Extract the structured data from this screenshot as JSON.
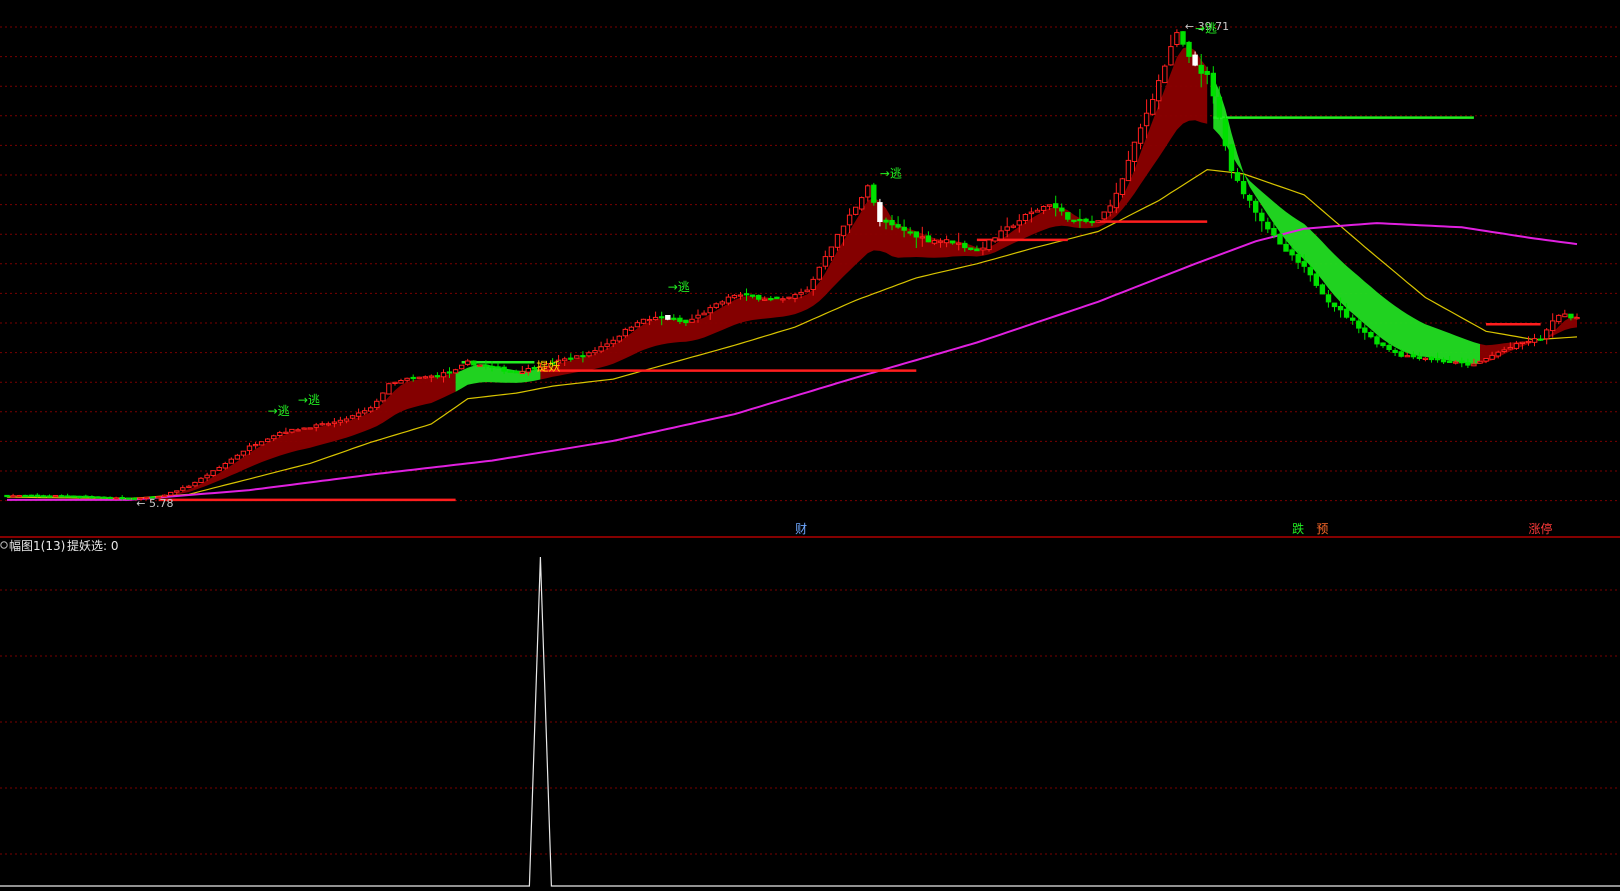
{
  "panel": {
    "title": "幅图1(13)",
    "indicator_label": "提妖选",
    "indicator_value": "0",
    "indicator_text": "提妖选: 0"
  },
  "colors": {
    "background": "#000000",
    "grid": "#7a0000",
    "panel_divider": "#b00000",
    "candle_up": "#ff1e1e",
    "candle_down": "#00e000",
    "candle_special": "#ffffff",
    "band_up": "#8b0000",
    "band_down": "#22dd22",
    "ma_yellow": "#d8c400",
    "ma_magenta": "#e020e0",
    "support_line": "#ff1e1e",
    "resist_line": "#22ee22",
    "sub_line": "#e8e8e8",
    "sell_label": "#22ee22",
    "price_label": "#c8c8c8",
    "tiyao_label": "#ffd000",
    "bottom_cai": "#6fa8ff",
    "bottom_die": "#22ee22",
    "bottom_yu": "#ff6a2a",
    "bottom_zhangting": "#ff3a3a"
  },
  "chart_data": [
    {
      "type": "candlestick",
      "title": "",
      "y_range": [
        5,
        41
      ],
      "candle_count": 260,
      "price_labels": [
        {
          "text": "39.71",
          "value": 39.71,
          "bar": 193
        },
        {
          "text": "5.78",
          "value": 5.78,
          "bar": 20
        }
      ],
      "sell_signals": [
        {
          "text": "逃",
          "bar": 42
        },
        {
          "text": "逃",
          "bar": 47
        },
        {
          "text": "逃",
          "bar": 108
        },
        {
          "text": "逃",
          "bar": 143
        },
        {
          "text": "逃",
          "bar": 195
        }
      ],
      "tiyao_signal": {
        "text": "提妖",
        "bar": 88
      },
      "bottom_markers": [
        {
          "text": "财",
          "bar": 131,
          "color_key": "bottom_cai"
        },
        {
          "text": "跌",
          "bar": 213,
          "color_key": "bottom_die"
        },
        {
          "text": "预",
          "bar": 217,
          "color_key": "bottom_yu"
        },
        {
          "text": "涨停",
          "bar": 252,
          "color_key": "bottom_zhangting"
        }
      ],
      "horizontal_levels": [
        {
          "kind": "support",
          "y": 6.0,
          "bar_start": 25,
          "bar_end": 74
        },
        {
          "kind": "support",
          "y": 15.2,
          "bar_start": 88,
          "bar_end": 150
        },
        {
          "kind": "support",
          "y": 24.5,
          "bar_start": 160,
          "bar_end": 175
        },
        {
          "kind": "support",
          "y": 25.8,
          "bar_start": 180,
          "bar_end": 198
        },
        {
          "kind": "support",
          "y": 18.5,
          "bar_start": 244,
          "bar_end": 253
        },
        {
          "kind": "resist",
          "y": 33.2,
          "bar_start": 199,
          "bar_end": 242
        },
        {
          "kind": "resist",
          "y": 15.8,
          "bar_start": 75,
          "bar_end": 87
        }
      ],
      "close_keypoints": [
        [
          0,
          6.3
        ],
        [
          10,
          6.3
        ],
        [
          20,
          6.1
        ],
        [
          25,
          6.2
        ],
        [
          30,
          7.0
        ],
        [
          35,
          8.3
        ],
        [
          40,
          9.8
        ],
        [
          45,
          10.8
        ],
        [
          50,
          11.2
        ],
        [
          55,
          11.6
        ],
        [
          60,
          12.5
        ],
        [
          63,
          14.2
        ],
        [
          66,
          14.6
        ],
        [
          70,
          14.8
        ],
        [
          74,
          15.2
        ],
        [
          76,
          15.8
        ],
        [
          80,
          15.4
        ],
        [
          84,
          15.1
        ],
        [
          88,
          15.5
        ],
        [
          92,
          16.0
        ],
        [
          96,
          16.4
        ],
        [
          100,
          17.4
        ],
        [
          104,
          18.7
        ],
        [
          108,
          19.0
        ],
        [
          112,
          18.6
        ],
        [
          116,
          19.6
        ],
        [
          120,
          20.6
        ],
        [
          124,
          20.4
        ],
        [
          128,
          20.2
        ],
        [
          132,
          20.9
        ],
        [
          135,
          23.4
        ],
        [
          140,
          26.9
        ],
        [
          142,
          28.4
        ],
        [
          144,
          25.8
        ],
        [
          148,
          25.2
        ],
        [
          152,
          24.5
        ],
        [
          156,
          24.4
        ],
        [
          160,
          23.7
        ],
        [
          163,
          24.7
        ],
        [
          168,
          26.2
        ],
        [
          172,
          27.1
        ],
        [
          176,
          25.8
        ],
        [
          180,
          25.8
        ],
        [
          183,
          27.7
        ],
        [
          186,
          31.3
        ],
        [
          190,
          35.8
        ],
        [
          193,
          39.2
        ],
        [
          195,
          37.4
        ],
        [
          198,
          36.1
        ],
        [
          200,
          33.2
        ],
        [
          202,
          29.3
        ],
        [
          206,
          26.6
        ],
        [
          210,
          24.1
        ],
        [
          214,
          22.5
        ],
        [
          218,
          20.2
        ],
        [
          222,
          18.7
        ],
        [
          226,
          17.2
        ],
        [
          230,
          16.3
        ],
        [
          234,
          16.1
        ],
        [
          238,
          15.8
        ],
        [
          242,
          15.6
        ],
        [
          246,
          16.5
        ],
        [
          250,
          17.2
        ],
        [
          253,
          17.5
        ],
        [
          256,
          19.2
        ],
        [
          259,
          19.0
        ]
      ],
      "ma_yellow_keypoints": [
        [
          0,
          6.2
        ],
        [
          20,
          6.1
        ],
        [
          30,
          6.4
        ],
        [
          40,
          7.5
        ],
        [
          50,
          8.6
        ],
        [
          60,
          10.1
        ],
        [
          70,
          11.4
        ],
        [
          76,
          13.2
        ],
        [
          84,
          13.6
        ],
        [
          90,
          14.1
        ],
        [
          100,
          14.6
        ],
        [
          110,
          15.8
        ],
        [
          120,
          17.0
        ],
        [
          130,
          18.3
        ],
        [
          140,
          20.2
        ],
        [
          150,
          21.8
        ],
        [
          160,
          22.8
        ],
        [
          170,
          24.0
        ],
        [
          180,
          25.1
        ],
        [
          190,
          27.3
        ],
        [
          198,
          29.5
        ],
        [
          204,
          29.2
        ],
        [
          214,
          27.7
        ],
        [
          224,
          24.0
        ],
        [
          234,
          20.4
        ],
        [
          244,
          18.0
        ],
        [
          252,
          17.4
        ],
        [
          259,
          17.6
        ]
      ],
      "ma_magenta_keypoints": [
        [
          0,
          6.0
        ],
        [
          20,
          6.0
        ],
        [
          40,
          6.7
        ],
        [
          60,
          7.8
        ],
        [
          80,
          8.8
        ],
        [
          100,
          10.2
        ],
        [
          120,
          12.1
        ],
        [
          140,
          14.7
        ],
        [
          160,
          17.2
        ],
        [
          180,
          20.1
        ],
        [
          196,
          22.8
        ],
        [
          206,
          24.4
        ],
        [
          214,
          25.3
        ],
        [
          226,
          25.7
        ],
        [
          240,
          25.4
        ],
        [
          252,
          24.6
        ],
        [
          259,
          24.2
        ]
      ],
      "band_up_ranges": [
        [
          25,
          74
        ],
        [
          88,
          198
        ],
        [
          243,
          259
        ]
      ],
      "band_down_ranges": [
        [
          199,
          243
        ],
        [
          0,
          20
        ],
        [
          74,
          88
        ]
      ]
    },
    {
      "type": "line",
      "title": "提妖选",
      "y_range": [
        0,
        1
      ],
      "spike_bar": 88,
      "baseline_value": 0,
      "spike_value": 1
    }
  ]
}
